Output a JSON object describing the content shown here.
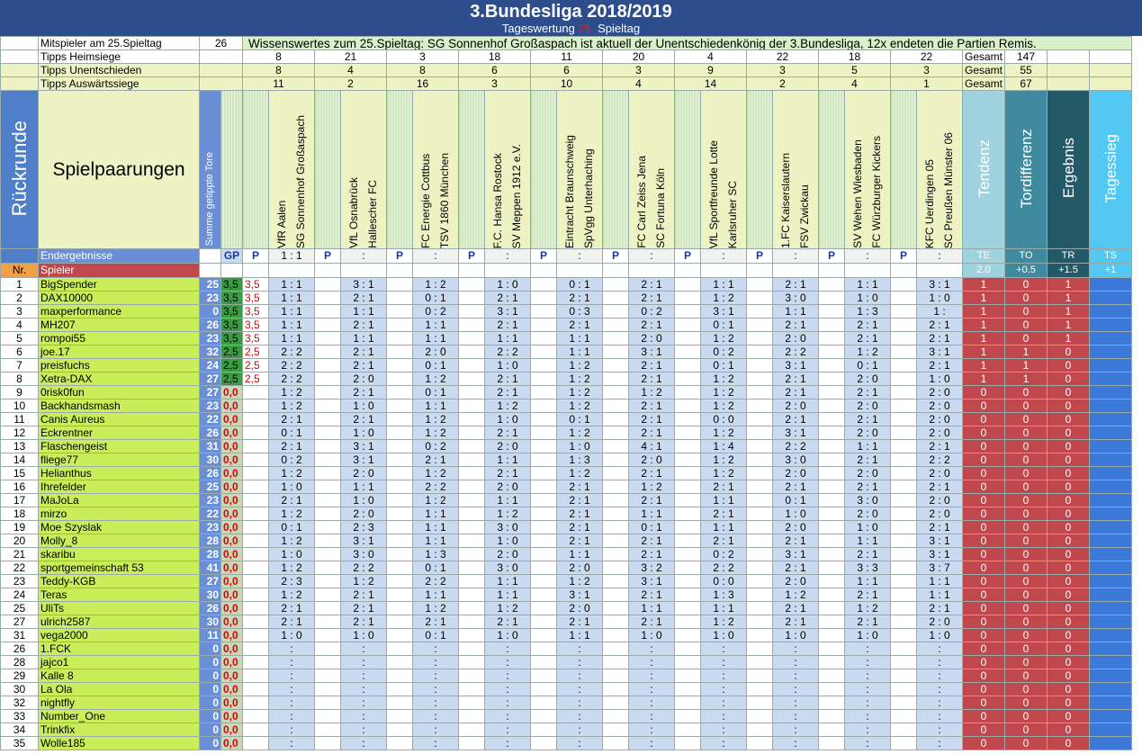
{
  "header": {
    "title": "3.Bundesliga 2018/2019",
    "subtitle_pre": "Tageswertung",
    "subtitle_num": "25.",
    "subtitle_post": "Spieltag"
  },
  "info": {
    "mitspieler_label": "Mitspieler am 25.Spieltag",
    "mitspieler_count": "26",
    "wissenswertes": "Wissenswertes zum 25.Spieltag: SG Sonnenhof Großaspach ist aktuell der Unentschiedenkönig der 3.Bundesliga, 12x endeten die Partien Remis.",
    "rows": [
      {
        "label": "Tipps Heimsiege",
        "values": [
          "8",
          "21",
          "3",
          "18",
          "11",
          "20",
          "4",
          "22",
          "18",
          "22"
        ],
        "gesamt_label": "Gesamt",
        "gesamt": "147"
      },
      {
        "label": "Tipps Unentschieden",
        "values": [
          "8",
          "4",
          "8",
          "6",
          "6",
          "3",
          "9",
          "3",
          "5",
          "3"
        ],
        "gesamt_label": "Gesamt",
        "gesamt": "55"
      },
      {
        "label": "Tipps Auswärtssiege",
        "values": [
          "11",
          "2",
          "16",
          "3",
          "10",
          "4",
          "14",
          "2",
          "4",
          "1"
        ],
        "gesamt_label": "Gesamt",
        "gesamt": "67"
      }
    ]
  },
  "labels": {
    "rueckrunde": "Rückrunde",
    "spielpaarungen": "Spielpaarungen",
    "summe": "Summe getippte Tore",
    "endergebnisse": "Endergebnisse",
    "nr": "Nr.",
    "spieler": "Spieler",
    "gp": "GP",
    "p": "P"
  },
  "matches": [
    {
      "home": "VfR Aalen",
      "away": "SG Sonnenhof Großaspach",
      "result": "1 : 1"
    },
    {
      "home": "VfL Osnabrück",
      "away": "Hallescher FC",
      "result": ":"
    },
    {
      "home": "FC Energie Cottbus",
      "away": "TSV 1860 München",
      "result": ":"
    },
    {
      "home": "F.C. Hansa Rostock",
      "away": "SV Meppen 1912 e.V.",
      "result": ":"
    },
    {
      "home": "Eintracht Braunschweig",
      "away": "SpVgg Unterhaching",
      "result": ":"
    },
    {
      "home": "FC Carl Zeiss Jena",
      "away": "SC Fortuna Köln",
      "result": ":"
    },
    {
      "home": "VfL Sportfreunde Lotte",
      "away": "Karlsruher SC",
      "result": ":"
    },
    {
      "home": "1.FC Kaiserslautern",
      "away": "FSV Zwickau",
      "result": ":"
    },
    {
      "home": "SV Wehen Wiesbaden",
      "away": "FC Würzburger Kickers",
      "result": ":"
    },
    {
      "home": "KFC Uerdingen 05",
      "away": "SC Preußen Münster 06",
      "result": ":"
    }
  ],
  "scoring": [
    {
      "name": "Tendenz",
      "code": "TE",
      "value": "2.0",
      "color": "#9fd3e0"
    },
    {
      "name": "Tordifferenz",
      "code": "TO",
      "value": "+0.5",
      "color": "#3f8a9e"
    },
    {
      "name": "Ergebnis",
      "code": "TR",
      "value": "+1.5",
      "color": "#245a68"
    },
    {
      "name": "Tagessieg",
      "code": "TS",
      "value": "+1",
      "color": "#52c8f2"
    }
  ],
  "players": [
    {
      "nr": "1",
      "name": "BigSpender",
      "sum": "25",
      "gp": "3,5",
      "p1": "3,5",
      "tips": [
        "1 : 1",
        "3 : 1",
        "1 : 2",
        "1 : 0",
        "0 : 1",
        "2 : 1",
        "1 : 1",
        "2 : 1",
        "1 : 1",
        "3 : 1"
      ],
      "te": "1",
      "to": "0",
      "tr": "1"
    },
    {
      "nr": "2",
      "name": "DAX10000",
      "sum": "23",
      "gp": "3,5",
      "p1": "3,5",
      "tips": [
        "1 : 1",
        "2 : 1",
        "0 : 1",
        "2 : 1",
        "2 : 1",
        "2 : 1",
        "1 : 2",
        "3 : 0",
        "1 : 0",
        "1 : 0"
      ],
      "te": "1",
      "to": "0",
      "tr": "1"
    },
    {
      "nr": "3",
      "name": "maxperformance",
      "sum": "0",
      "gp": "3,5",
      "p1": "3,5",
      "tips": [
        "1 : 1",
        "1 : 1",
        "0 : 2",
        "3 : 1",
        "0 : 3",
        "0 : 2",
        "3 : 1",
        "1 : 1",
        "1 : 3",
        "1 :"
      ],
      "te": "1",
      "to": "0",
      "tr": "1"
    },
    {
      "nr": "4",
      "name": "MH207",
      "sum": "26",
      "gp": "3,5",
      "p1": "3,5",
      "tips": [
        "1 : 1",
        "2 : 1",
        "1 : 1",
        "2 : 1",
        "2 : 1",
        "2 : 1",
        "0 : 1",
        "2 : 1",
        "2 : 1",
        "2 : 1"
      ],
      "te": "1",
      "to": "0",
      "tr": "1"
    },
    {
      "nr": "5",
      "name": "rompoi55",
      "sum": "23",
      "gp": "3,5",
      "p1": "3,5",
      "tips": [
        "1 : 1",
        "1 : 1",
        "1 : 1",
        "1 : 1",
        "1 : 1",
        "2 : 0",
        "1 : 2",
        "2 : 0",
        "2 : 1",
        "2 : 1"
      ],
      "te": "1",
      "to": "0",
      "tr": "1"
    },
    {
      "nr": "6",
      "name": "joe.17",
      "sum": "32",
      "gp": "2,5",
      "p1": "2,5",
      "tips": [
        "2 : 2",
        "2 : 1",
        "2 : 0",
        "2 : 2",
        "1 : 1",
        "3 : 1",
        "0 : 2",
        "2 : 2",
        "1 : 2",
        "3 : 1"
      ],
      "te": "1",
      "to": "1",
      "tr": "0"
    },
    {
      "nr": "7",
      "name": "preisfuchs",
      "sum": "24",
      "gp": "2,5",
      "p1": "2,5",
      "tips": [
        "2 : 2",
        "2 : 1",
        "0 : 1",
        "1 : 0",
        "1 : 2",
        "2 : 1",
        "0 : 1",
        "3 : 1",
        "0 : 1",
        "2 : 1"
      ],
      "te": "1",
      "to": "1",
      "tr": "0"
    },
    {
      "nr": "8",
      "name": "Xetra-DAX",
      "sum": "27",
      "gp": "2,5",
      "p1": "2,5",
      "tips": [
        "2 : 2",
        "2 : 0",
        "1 : 2",
        "2 : 1",
        "1 : 2",
        "2 : 1",
        "1 : 2",
        "2 : 1",
        "2 : 0",
        "1 : 0"
      ],
      "te": "1",
      "to": "1",
      "tr": "0"
    },
    {
      "nr": "9",
      "name": "0risk0fun",
      "sum": "27",
      "gp": "0,0",
      "p1": "",
      "tips": [
        "1 : 2",
        "2 : 1",
        "0 : 1",
        "2 : 1",
        "1 : 2",
        "1 : 2",
        "1 : 2",
        "2 : 1",
        "2 : 1",
        "2 : 0"
      ],
      "te": "0",
      "to": "0",
      "tr": "0"
    },
    {
      "nr": "10",
      "name": "Backhandsmash",
      "sum": "23",
      "gp": "0,0",
      "p1": "",
      "tips": [
        "1 : 2",
        "1 : 0",
        "1 : 1",
        "1 : 2",
        "1 : 2",
        "2 : 1",
        "1 : 2",
        "2 : 0",
        "2 : 0",
        "2 : 0"
      ],
      "te": "0",
      "to": "0",
      "tr": "0"
    },
    {
      "nr": "11",
      "name": "Canis Aureus",
      "sum": "22",
      "gp": "0,0",
      "p1": "",
      "tips": [
        "2 : 1",
        "2 : 1",
        "1 : 2",
        "1 : 0",
        "0 : 1",
        "2 : 1",
        "0 : 0",
        "2 : 1",
        "2 : 1",
        "2 : 0"
      ],
      "te": "0",
      "to": "0",
      "tr": "0"
    },
    {
      "nr": "12",
      "name": "Eckrentner",
      "sum": "26",
      "gp": "0,0",
      "p1": "",
      "tips": [
        "0 : 1",
        "1 : 0",
        "1 : 2",
        "2 : 1",
        "1 : 2",
        "2 : 1",
        "1 : 2",
        "3 : 1",
        "2 : 0",
        "2 : 0"
      ],
      "te": "0",
      "to": "0",
      "tr": "0"
    },
    {
      "nr": "13",
      "name": "Flaschengeist",
      "sum": "31",
      "gp": "0,0",
      "p1": "",
      "tips": [
        "2 : 1",
        "3 : 1",
        "0 : 2",
        "2 : 0",
        "1 : 0",
        "4 : 1",
        "1 : 4",
        "2 : 2",
        "1 : 1",
        "2 : 1"
      ],
      "te": "0",
      "to": "0",
      "tr": "0"
    },
    {
      "nr": "14",
      "name": "fliege77",
      "sum": "30",
      "gp": "0,0",
      "p1": "",
      "tips": [
        "0 : 2",
        "3 : 1",
        "2 : 1",
        "1 : 1",
        "1 : 3",
        "2 : 0",
        "1 : 2",
        "3 : 0",
        "2 : 1",
        "2 : 2"
      ],
      "te": "0",
      "to": "0",
      "tr": "0"
    },
    {
      "nr": "15",
      "name": "Helianthus",
      "sum": "26",
      "gp": "0,0",
      "p1": "",
      "tips": [
        "1 : 2",
        "2 : 0",
        "1 : 2",
        "2 : 1",
        "1 : 2",
        "2 : 1",
        "1 : 2",
        "2 : 0",
        "2 : 0",
        "2 : 0"
      ],
      "te": "0",
      "to": "0",
      "tr": "0"
    },
    {
      "nr": "16",
      "name": "Ihrefelder",
      "sum": "25",
      "gp": "0,0",
      "p1": "",
      "tips": [
        "1 : 0",
        "1 : 1",
        "2 : 2",
        "2 : 0",
        "2 : 1",
        "1 : 2",
        "2 : 1",
        "2 : 1",
        "2 : 1",
        "2 : 1"
      ],
      "te": "0",
      "to": "0",
      "tr": "0"
    },
    {
      "nr": "17",
      "name": "MaJoLa",
      "sum": "23",
      "gp": "0,0",
      "p1": "",
      "tips": [
        "2 : 1",
        "1 : 0",
        "1 : 2",
        "1 : 1",
        "2 : 1",
        "2 : 1",
        "1 : 1",
        "0 : 1",
        "3 : 0",
        "2 : 0"
      ],
      "te": "0",
      "to": "0",
      "tr": "0"
    },
    {
      "nr": "18",
      "name": "mirzo",
      "sum": "22",
      "gp": "0,0",
      "p1": "",
      "tips": [
        "1 : 2",
        "2 : 0",
        "1 : 1",
        "1 : 2",
        "2 : 1",
        "1 : 1",
        "2 : 1",
        "1 : 0",
        "2 : 0",
        "2 : 0"
      ],
      "te": "0",
      "to": "0",
      "tr": "0"
    },
    {
      "nr": "19",
      "name": "Moe Szyslak",
      "sum": "23",
      "gp": "0,0",
      "p1": "",
      "tips": [
        "0 : 1",
        "2 : 3",
        "1 : 1",
        "3 : 0",
        "2 : 1",
        "0 : 1",
        "1 : 1",
        "2 : 0",
        "1 : 0",
        "2 : 1"
      ],
      "te": "0",
      "to": "0",
      "tr": "0"
    },
    {
      "nr": "20",
      "name": "Molly_8",
      "sum": "28",
      "gp": "0,0",
      "p1": "",
      "tips": [
        "1 : 2",
        "3 : 1",
        "1 : 1",
        "1 : 0",
        "2 : 1",
        "2 : 1",
        "2 : 1",
        "2 : 1",
        "1 : 1",
        "3 : 1"
      ],
      "te": "0",
      "to": "0",
      "tr": "0"
    },
    {
      "nr": "21",
      "name": "skaribu",
      "sum": "28",
      "gp": "0,0",
      "p1": "",
      "tips": [
        "1 : 0",
        "3 : 0",
        "1 : 3",
        "2 : 0",
        "1 : 1",
        "2 : 1",
        "0 : 2",
        "3 : 1",
        "2 : 1",
        "3 : 1"
      ],
      "te": "0",
      "to": "0",
      "tr": "0"
    },
    {
      "nr": "22",
      "name": "sportgemeinschaft 53",
      "sum": "41",
      "gp": "0,0",
      "p1": "",
      "tips": [
        "1 : 2",
        "2 : 2",
        "0 : 1",
        "3 : 0",
        "2 : 0",
        "3 : 2",
        "2 : 2",
        "2 : 1",
        "3 : 3",
        "3 : 7"
      ],
      "te": "0",
      "to": "0",
      "tr": "0"
    },
    {
      "nr": "23",
      "name": "Teddy-KGB",
      "sum": "27",
      "gp": "0,0",
      "p1": "",
      "tips": [
        "2 : 3",
        "1 : 2",
        "2 : 2",
        "1 : 1",
        "1 : 2",
        "3 : 1",
        "0 : 0",
        "2 : 0",
        "1 : 1",
        "1 : 1"
      ],
      "te": "0",
      "to": "0",
      "tr": "0"
    },
    {
      "nr": "24",
      "name": "Teras",
      "sum": "30",
      "gp": "0,0",
      "p1": "",
      "tips": [
        "1 : 2",
        "2 : 1",
        "1 : 1",
        "1 : 1",
        "3 : 1",
        "2 : 1",
        "1 : 3",
        "1 : 2",
        "2 : 1",
        "1 : 1"
      ],
      "te": "0",
      "to": "0",
      "tr": "0"
    },
    {
      "nr": "25",
      "name": "UliTs",
      "sum": "26",
      "gp": "0,0",
      "p1": "",
      "tips": [
        "2 : 1",
        "2 : 1",
        "1 : 2",
        "1 : 2",
        "2 : 0",
        "1 : 1",
        "1 : 1",
        "2 : 1",
        "1 : 2",
        "2 : 1"
      ],
      "te": "0",
      "to": "0",
      "tr": "0"
    },
    {
      "nr": "27",
      "name": "ulrich2587",
      "sum": "30",
      "gp": "0,0",
      "p1": "",
      "tips": [
        "2 : 1",
        "2 : 1",
        "2 : 1",
        "2 : 1",
        "2 : 1",
        "2 : 1",
        "1 : 2",
        "2 : 1",
        "2 : 1",
        "2 : 0"
      ],
      "te": "0",
      "to": "0",
      "tr": "0"
    },
    {
      "nr": "31",
      "name": "vega2000",
      "sum": "11",
      "gp": "0,0",
      "p1": "",
      "tips": [
        "1 : 0",
        "1 : 0",
        "0 : 1",
        "1 : 0",
        "1 : 1",
        "1 : 0",
        "1 : 0",
        "1 : 0",
        "1 : 0",
        "1 : 0"
      ],
      "te": "0",
      "to": "0",
      "tr": "0"
    },
    {
      "nr": "26",
      "name": "1.FCK",
      "sum": "0",
      "gp": "0,0",
      "p1": "",
      "tips": [
        ":",
        ":",
        ":",
        ":",
        ":",
        ":",
        ":",
        ":",
        ":",
        ":"
      ],
      "te": "0",
      "to": "0",
      "tr": "0"
    },
    {
      "nr": "28",
      "name": "jajco1",
      "sum": "0",
      "gp": "0,0",
      "p1": "",
      "tips": [
        ":",
        ":",
        ":",
        ":",
        ":",
        ":",
        ":",
        ":",
        ":",
        ":"
      ],
      "te": "0",
      "to": "0",
      "tr": "0"
    },
    {
      "nr": "29",
      "name": "Kalle 8",
      "sum": "0",
      "gp": "0,0",
      "p1": "",
      "tips": [
        ":",
        ":",
        ":",
        ":",
        ":",
        ":",
        ":",
        ":",
        ":",
        ":"
      ],
      "te": "0",
      "to": "0",
      "tr": "0"
    },
    {
      "nr": "30",
      "name": "La Ola",
      "sum": "0",
      "gp": "0,0",
      "p1": "",
      "tips": [
        ":",
        ":",
        ":",
        ":",
        ":",
        ":",
        ":",
        ":",
        ":",
        ":"
      ],
      "te": "0",
      "to": "0",
      "tr": "0"
    },
    {
      "nr": "32",
      "name": "nightfly",
      "sum": "0",
      "gp": "0,0",
      "p1": "",
      "tips": [
        ":",
        ":",
        ":",
        ":",
        ":",
        ":",
        ":",
        ":",
        ":",
        ":"
      ],
      "te": "0",
      "to": "0",
      "tr": "0"
    },
    {
      "nr": "33",
      "name": "Number_One",
      "sum": "0",
      "gp": "0,0",
      "p1": "",
      "tips": [
        ":",
        ":",
        ":",
        ":",
        ":",
        ":",
        ":",
        ":",
        ":",
        ":"
      ],
      "te": "0",
      "to": "0",
      "tr": "0"
    },
    {
      "nr": "34",
      "name": "Trinkfix",
      "sum": "0",
      "gp": "0,0",
      "p1": "",
      "tips": [
        ":",
        ":",
        ":",
        ":",
        ":",
        ":",
        ":",
        ":",
        ":",
        ":"
      ],
      "te": "0",
      "to": "0",
      "tr": "0"
    },
    {
      "nr": "35",
      "name": "Wolle185",
      "sum": "0",
      "gp": "0,0",
      "p1": "",
      "tips": [
        ":",
        ":",
        ":",
        ":",
        ":",
        ":",
        ":",
        ":",
        ":",
        ":"
      ],
      "te": "0",
      "to": "0",
      "tr": "0"
    }
  ]
}
